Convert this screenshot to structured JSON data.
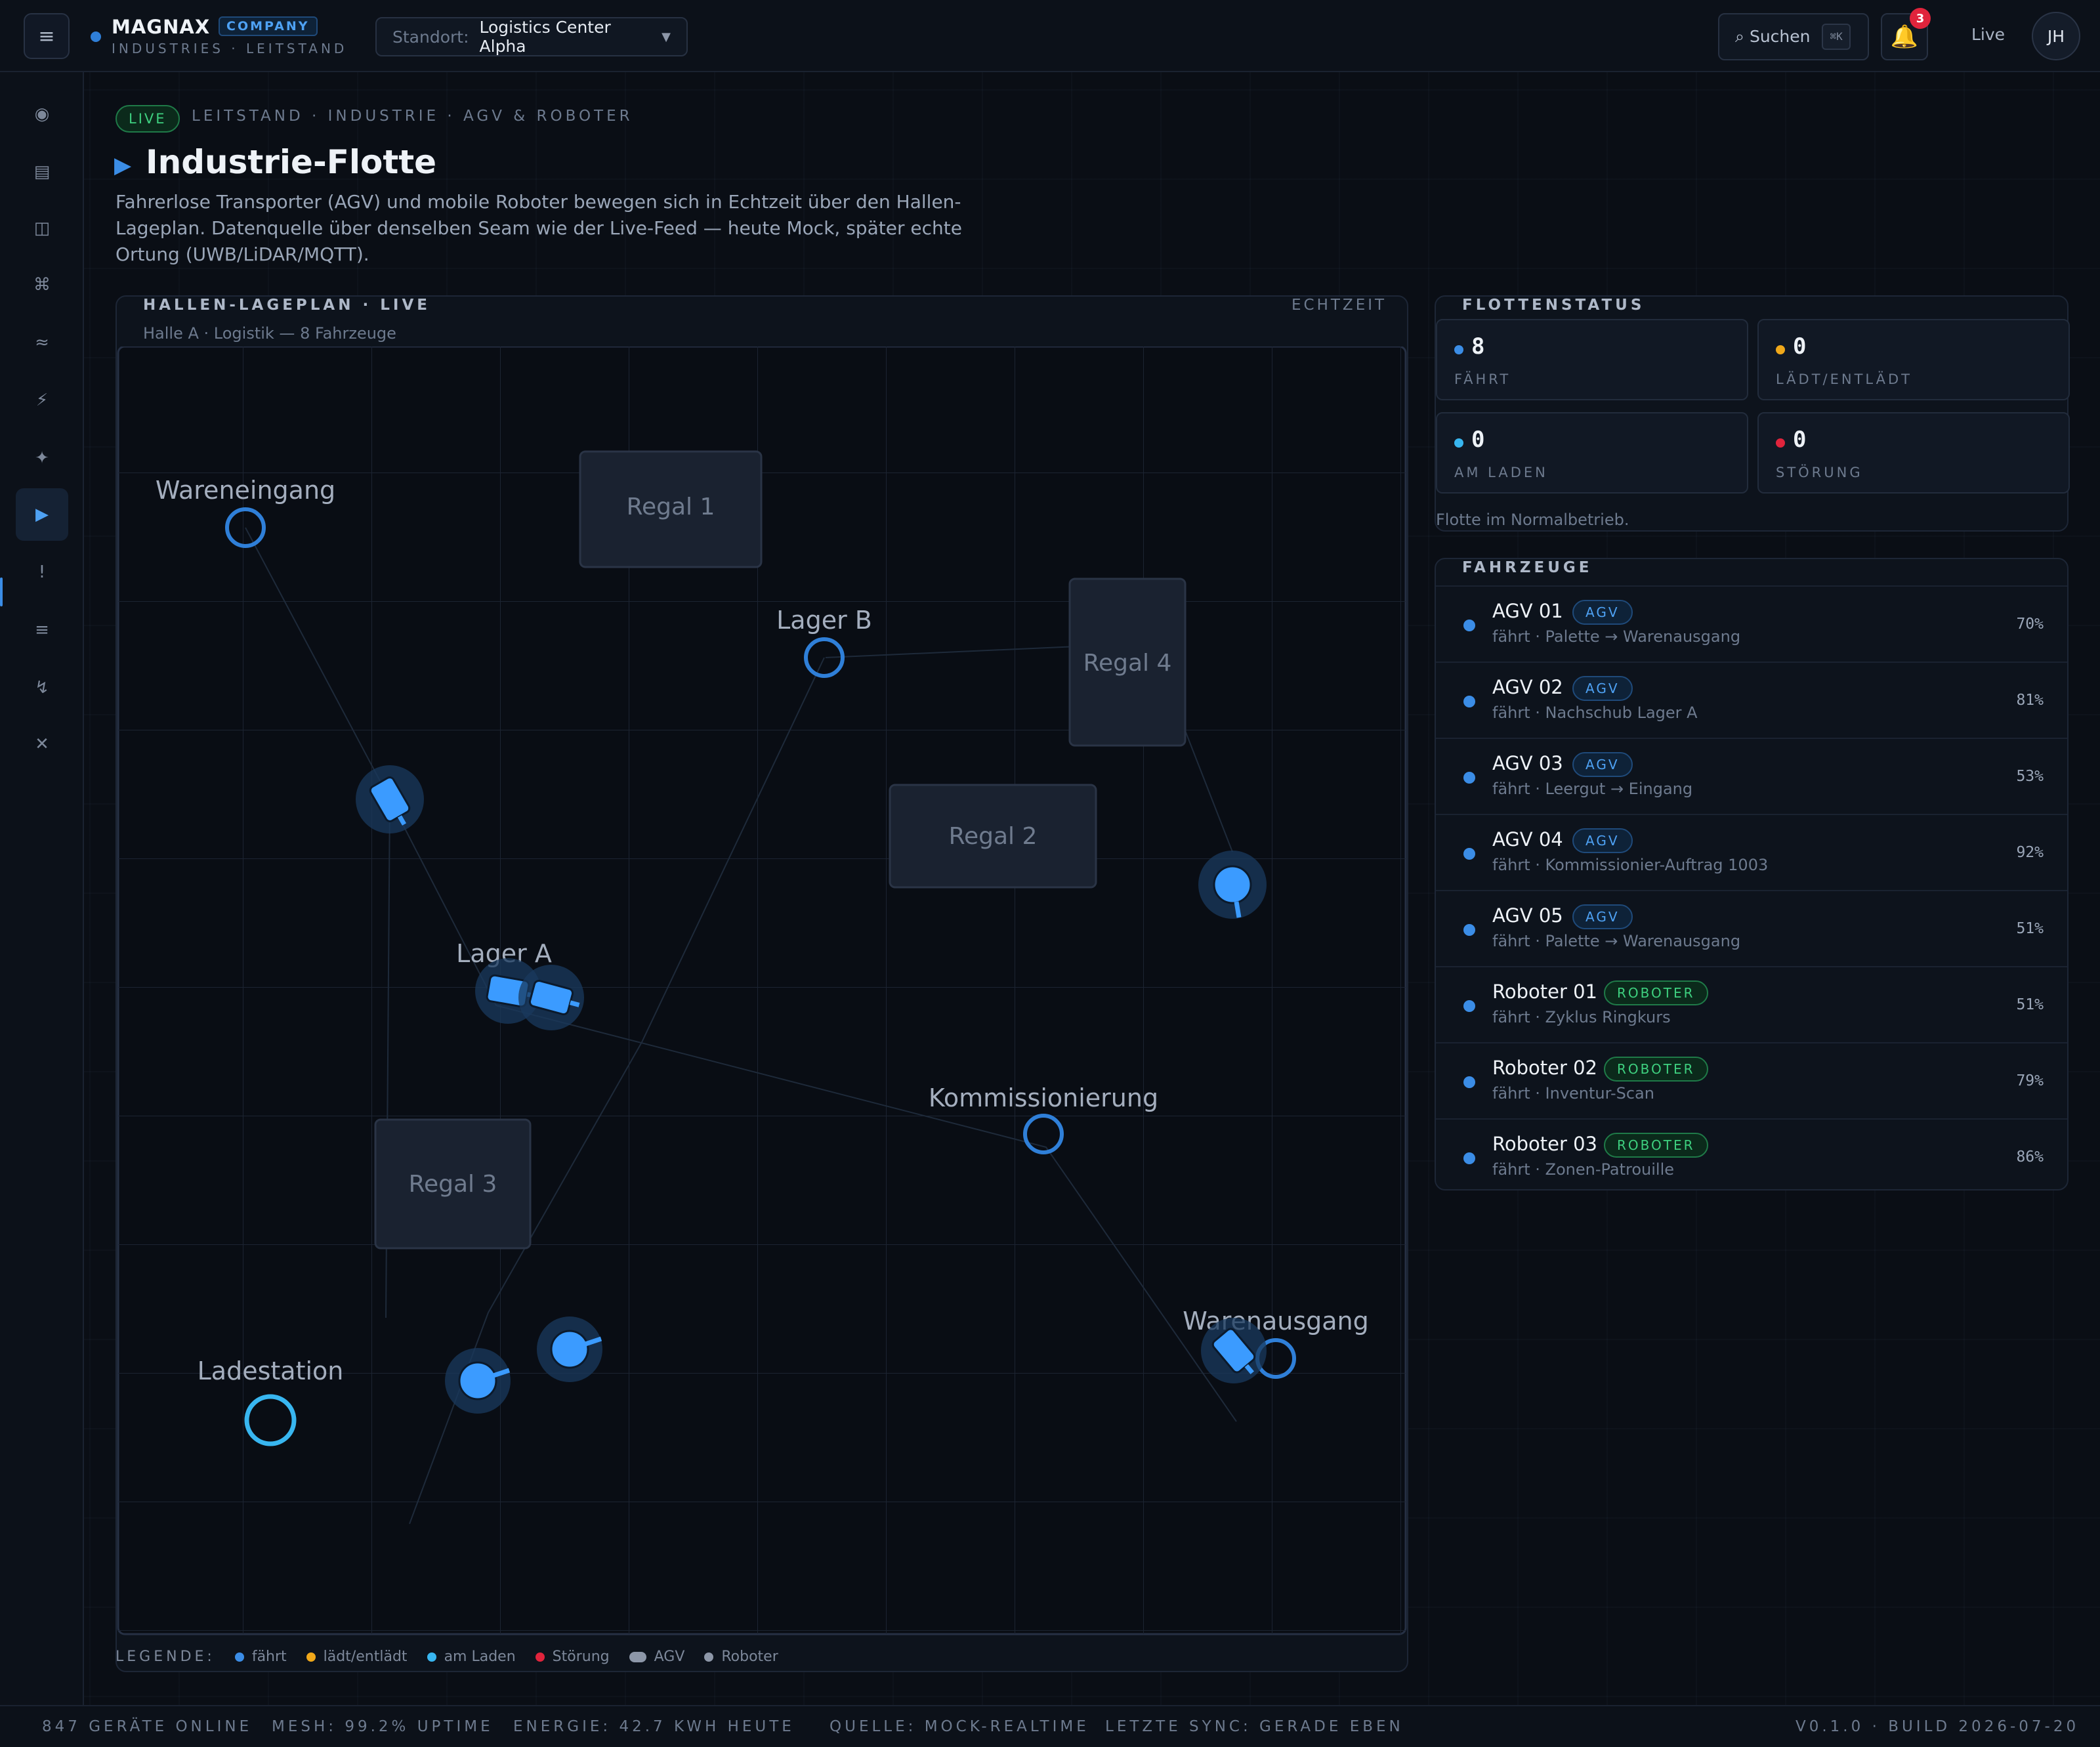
{
  "topbar": {
    "brand_name": "MAGNAX",
    "brand_badge": "COMPANY",
    "brand_sub": "INDUSTRIES · LEITSTAND",
    "site_label": "Standort:",
    "site_value": "Logistics Center Alpha",
    "search_label": "⌕ Suchen",
    "search_kbd": "⌘K",
    "notifications_count": "3",
    "live_label": "Live",
    "avatar_initials": "JH"
  },
  "sidebar": {
    "icons": [
      "dashboard-icon",
      "devices-icon",
      "panels-icon",
      "command-icon",
      "stream-icon",
      "energy-icon",
      "ai-icon",
      "fleet-icon",
      "alert-icon",
      "list-icon",
      "automation-icon",
      "close-icon"
    ],
    "glyphs": [
      "◉",
      "▤",
      "◫",
      "⌘",
      "≈",
      "⚡",
      "✦",
      "▶",
      "!",
      "≡",
      "↯",
      "✕"
    ],
    "active_index": 7
  },
  "header": {
    "live_chip": "LIVE",
    "breadcrumb": "LEITSTAND · INDUSTRIE · AGV & ROBOTER",
    "title": "Industrie-Flotte",
    "description": "Fahrerlose Transporter (AGV) und mobile Roboter bewegen sich in Echtzeit über den Hallen-Lageplan. Datenquelle über denselben Seam wie der Live-Feed — heute Mock, später echte Ortung (UWB/LiDAR/MQTT)."
  },
  "map": {
    "title": "HALLEN-LAGEPLAN · LIVE",
    "realtime_label": "ECHTZEIT",
    "subtitle": "Halle A · Logistik — 8 Fahrzeuge",
    "shelves": [
      "Regal 1",
      "Regal 4",
      "Regal 2",
      "Regal 3"
    ],
    "stations": [
      "Wareneingang",
      "Lager B",
      "Lager A",
      "Kommissionierung",
      "Ladestation",
      "Warenausgang"
    ]
  },
  "legend": {
    "title": "LEGENDE:",
    "items": [
      {
        "label": "fährt",
        "color": "#3b8de6"
      },
      {
        "label": "lädt/entlädt",
        "color": "#f0a81a"
      },
      {
        "label": "am Laden",
        "color": "#38b6f0"
      },
      {
        "label": "Störung",
        "color": "#e0243c"
      },
      {
        "label": "AGV",
        "color": "#8d97a8"
      },
      {
        "label": "Roboter",
        "color": "#8d97a8"
      }
    ]
  },
  "fleet_status": {
    "title": "FLOTTENSTATUS",
    "cards": [
      {
        "value": "8",
        "label": "FÄHRT",
        "color": "#3b8de6"
      },
      {
        "value": "0",
        "label": "LÄDT/ENTLÄDT",
        "color": "#f0a81a"
      },
      {
        "value": "0",
        "label": "AM LADEN",
        "color": "#38b6f0"
      },
      {
        "value": "0",
        "label": "STÖRUNG",
        "color": "#e0243c"
      }
    ],
    "note": "Flotte im Normalbetrieb."
  },
  "vehicles": {
    "title": "FAHRZEUGE",
    "rows": [
      {
        "name": "AGV 01",
        "tag": "AGV",
        "task": "fährt · Palette → Warenausgang",
        "battery": "70%"
      },
      {
        "name": "AGV 02",
        "tag": "AGV",
        "task": "fährt · Nachschub Lager A",
        "battery": "81%"
      },
      {
        "name": "AGV 03",
        "tag": "AGV",
        "task": "fährt · Leergut → Eingang",
        "battery": "53%"
      },
      {
        "name": "AGV 04",
        "tag": "AGV",
        "task": "fährt · Kommissionier-Auftrag 1003",
        "battery": "92%"
      },
      {
        "name": "AGV 05",
        "tag": "AGV",
        "task": "fährt · Palette → Warenausgang",
        "battery": "51%"
      },
      {
        "name": "Roboter 01",
        "tag": "ROBOTER",
        "task": "fährt · Zyklus Ringkurs",
        "battery": "51%"
      },
      {
        "name": "Roboter 02",
        "tag": "ROBOTER",
        "task": "fährt · Inventur-Scan",
        "battery": "79%"
      },
      {
        "name": "Roboter 03",
        "tag": "ROBOTER",
        "task": "fährt · Zonen-Patrouille",
        "battery": "86%"
      }
    ]
  },
  "footer": {
    "devices": "847 GERÄTE ONLINE",
    "mesh": "MESH: 99.2% UPTIME",
    "energy": "ENERGIE: 42.7 KWH HEUTE",
    "source": "QUELLE: MOCK-REALTIME",
    "sync": "LETZTE SYNC: GERADE EBEN",
    "version": "V0.1.0 · BUILD 2026-07-20"
  }
}
